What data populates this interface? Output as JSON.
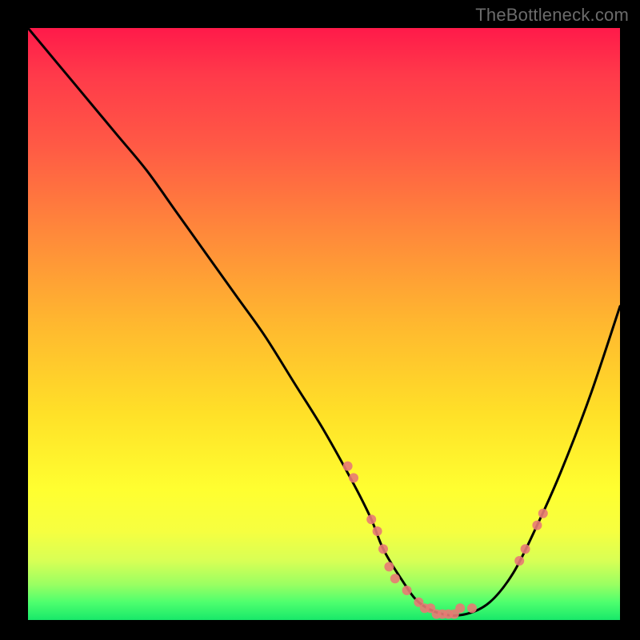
{
  "watermark": "TheBottleneck.com",
  "colors": {
    "background_frame": "#000000",
    "gradient_top": "#ff1a4a",
    "gradient_mid_upper": "#ff8a3a",
    "gradient_mid_lower": "#ffe028",
    "gradient_bottom": "#18e86a",
    "curve": "#000000",
    "points": "#e87a74"
  },
  "chart_data": {
    "type": "line",
    "title": "",
    "xlabel": "",
    "ylabel": "",
    "xlim": [
      0,
      100
    ],
    "ylim": [
      0,
      100
    ],
    "grid": false,
    "legend": false,
    "series": [
      {
        "name": "bottleneck-curve",
        "x": [
          0,
          5,
          10,
          15,
          20,
          25,
          30,
          35,
          40,
          45,
          50,
          55,
          58,
          60,
          63,
          66,
          70,
          74,
          78,
          82,
          86,
          90,
          95,
          100
        ],
        "values": [
          100,
          94,
          88,
          82,
          76,
          69,
          62,
          55,
          48,
          40,
          32,
          23,
          17,
          12,
          7,
          3,
          1,
          1,
          3,
          8,
          16,
          25,
          38,
          53
        ]
      }
    ],
    "scatter_points": {
      "name": "sample-dots",
      "x": [
        54,
        55,
        58,
        59,
        60,
        61,
        62,
        64,
        66,
        67,
        68,
        69,
        70,
        71,
        72,
        73,
        75,
        83,
        84,
        86,
        87
      ],
      "values": [
        26,
        24,
        17,
        15,
        12,
        9,
        7,
        5,
        3,
        2,
        2,
        1,
        1,
        1,
        1,
        2,
        2,
        10,
        12,
        16,
        18
      ]
    }
  }
}
